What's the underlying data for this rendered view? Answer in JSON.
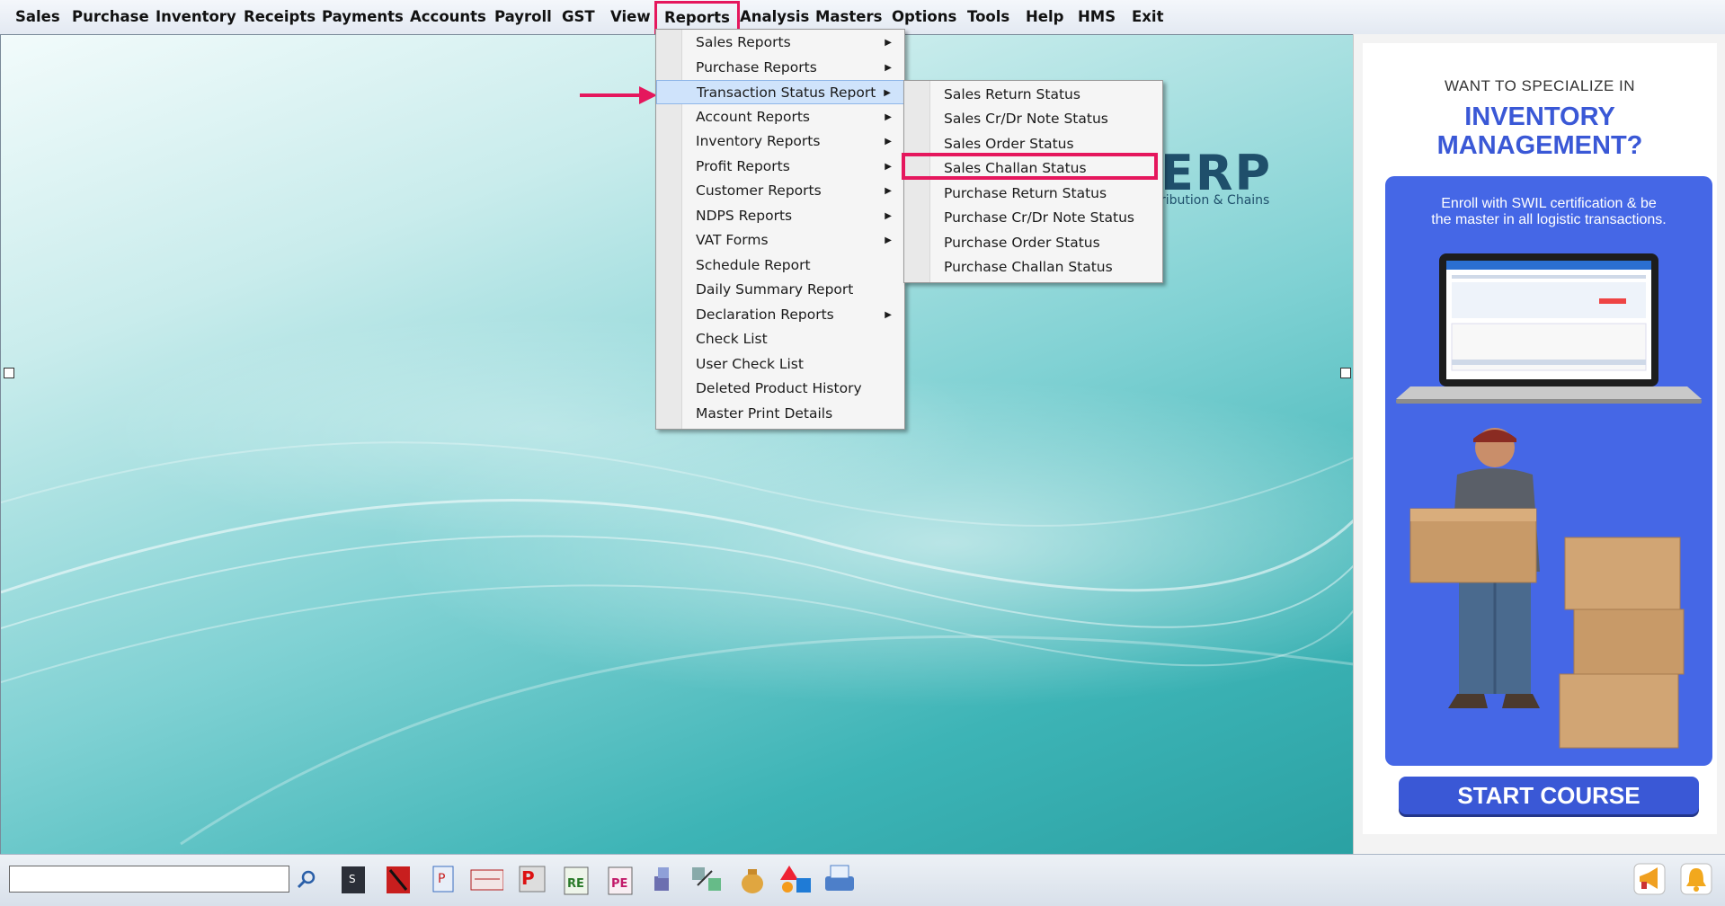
{
  "menubar": {
    "items": [
      "Sales",
      "Purchase",
      "Inventory",
      "Receipts",
      "Payments",
      "Accounts",
      "Payroll",
      "GST",
      "View",
      "Reports",
      "Analysis",
      "Masters",
      "Options",
      "Tools",
      "Help",
      "HMS",
      "Exit"
    ],
    "active": "Reports"
  },
  "reports_menu": {
    "items": [
      {
        "label": "Sales Reports",
        "submenu": true
      },
      {
        "label": "Purchase Reports",
        "submenu": true
      },
      {
        "label": "Transaction Status Report",
        "submenu": true,
        "highlighted": true
      },
      {
        "label": "Account Reports",
        "submenu": true
      },
      {
        "label": "Inventory Reports",
        "submenu": true
      },
      {
        "label": "Profit Reports",
        "submenu": true
      },
      {
        "label": "Customer Reports",
        "submenu": true
      },
      {
        "label": "NDPS Reports",
        "submenu": true
      },
      {
        "label": "VAT Forms",
        "submenu": true
      },
      {
        "label": "Schedule Report",
        "submenu": false
      },
      {
        "label": "Daily Summary Report",
        "submenu": false
      },
      {
        "label": "Declaration Reports",
        "submenu": true
      },
      {
        "label": "Check List",
        "submenu": false
      },
      {
        "label": "User Check List",
        "submenu": false
      },
      {
        "label": "Deleted Product History",
        "submenu": false
      },
      {
        "label": "Master Print Details",
        "submenu": false
      }
    ]
  },
  "status_submenu": {
    "items": [
      "Sales Return Status",
      "Sales Cr/Dr Note Status",
      "Sales Order Status",
      "Sales Challan Status",
      "Purchase Return Status",
      "Purchase Cr/Dr Note Status",
      "Purchase Order Status",
      "Purchase Challan Status"
    ],
    "boxed": "Sales Challan Status"
  },
  "background_logo": {
    "text": "ERP",
    "subtext": "ribution & Chains"
  },
  "ad": {
    "small_heading": "WANT TO SPECIALIZE IN",
    "title_line1": "INVENTORY",
    "title_line2": "MANAGEMENT?",
    "enroll_line1": "Enroll with SWIL certification & be",
    "enroll_line2": "the master in all logistic transactions.",
    "cta": "START COURSE"
  },
  "toolbar": {
    "icons": [
      "sales-slip-icon",
      "cancel-slip-icon",
      "purchase-bill-icon",
      "check-book-icon",
      "purchase-register-icon",
      "re-register-icon",
      "pe-register-icon",
      "stock-icon",
      "inventory-transfer-icon",
      "cash-bag-icon",
      "shapes-icon",
      "printer-icon"
    ],
    "right_icons": [
      "announcement-icon",
      "notification-bell-icon"
    ]
  },
  "colors": {
    "highlight_red": "#e5175d",
    "menu_hover": "#cfe3fb",
    "ad_blue": "#4567e6"
  }
}
